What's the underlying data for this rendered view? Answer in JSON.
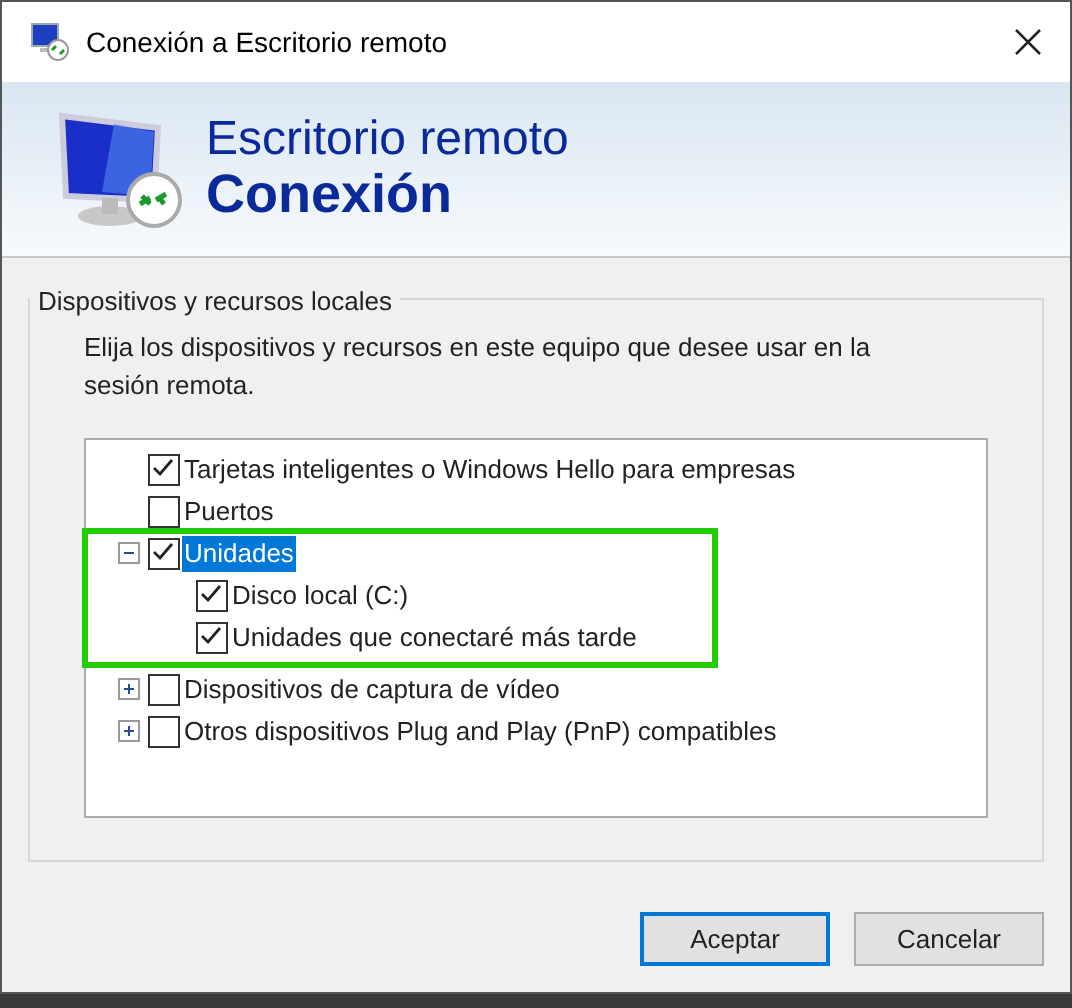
{
  "window": {
    "title": "Conexión a Escritorio remoto"
  },
  "banner": {
    "line_1": "Escritorio remoto",
    "line_2": "Conexión"
  },
  "group": {
    "title": "Dispositivos y recursos locales",
    "description": "Elija los dispositivos y recursos en este equipo que desee usar en la sesión remota."
  },
  "tree": [
    {
      "label": "Tarjetas inteligentes o Windows Hello para empresas",
      "checked": true,
      "selected": false
    },
    {
      "label": "Puertos",
      "checked": false,
      "selected": false
    },
    {
      "label": "Unidades",
      "checked": true,
      "selected": true,
      "expanded": true,
      "children": [
        {
          "label": "Disco local (C:)",
          "checked": true,
          "selected": false
        },
        {
          "label": "Unidades que conectaré más tarde",
          "checked": true,
          "selected": false
        }
      ]
    },
    {
      "label": "Dispositivos de captura de vídeo",
      "checked": false,
      "selected": false,
      "expanded": false
    },
    {
      "label": "Otros dispositivos Plug and Play (PnP) compatibles",
      "checked": false,
      "selected": false,
      "expanded": false
    }
  ],
  "buttons": [
    {
      "label": "Aceptar",
      "default": true
    },
    {
      "label": "Cancelar",
      "default": false
    }
  ]
}
